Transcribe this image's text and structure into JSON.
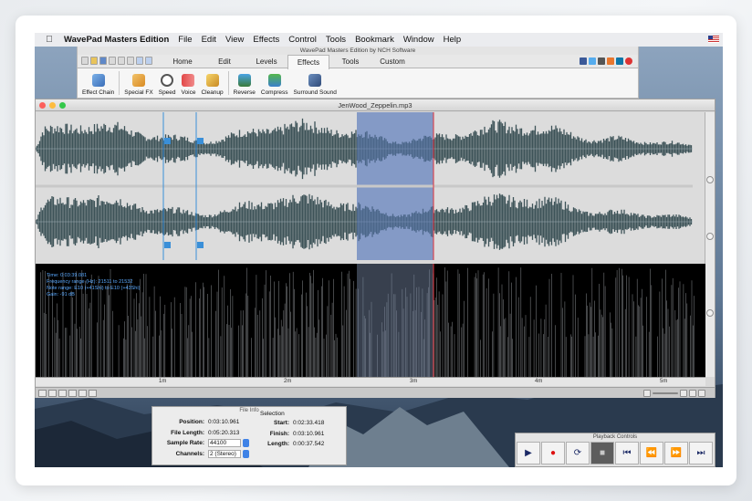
{
  "menubar": {
    "app_name": "WavePad Masters Edition",
    "items": [
      "File",
      "Edit",
      "View",
      "Effects",
      "Control",
      "Tools",
      "Bookmark",
      "Window",
      "Help"
    ]
  },
  "ribbon": {
    "window_title": "WavePad Masters Edition by NCH Software",
    "tabs": [
      "Home",
      "Edit",
      "Levels",
      "Effects",
      "Tools",
      "Custom"
    ],
    "active_tab": "Effects",
    "tools": [
      "Effect Chain",
      "Special FX",
      "Speed",
      "Voice",
      "Cleanup",
      "Reverse",
      "Compress",
      "Surround Sound"
    ]
  },
  "editor": {
    "file_title": "JenWood_Zeppelin.mp3",
    "spectrogram_info": [
      "Time: 0:03:39.081",
      "Frequency range (Hz): 21511 to 21532",
      "Note range: E10 (+41Shi) to E10 (+43Shi)",
      "Gain: -91 dB"
    ],
    "timeline_labels": [
      "1m",
      "2m",
      "3m",
      "4m",
      "5m"
    ],
    "markers": [
      "1",
      "2"
    ]
  },
  "file_info": {
    "title": "File Info",
    "position_label": "Position:",
    "position": "0:03:10.961",
    "length_label": "File Length:",
    "length": "0:05:20.313",
    "rate_label": "Sample Rate:",
    "rate": "44100",
    "channels_label": "Channels:",
    "channels": "2 (Stereo)",
    "selection_label": "Selection",
    "start_label": "Start:",
    "start": "0:02:33.418",
    "finish_label": "Finish:",
    "finish": "0:03:10.961",
    "sel_length_label": "Length:",
    "sel_length": "0:00:37.542"
  },
  "playback": {
    "title": "Playback Controls",
    "buttons": [
      "play",
      "record",
      "loop",
      "stop",
      "go-to-start",
      "rewind",
      "fast-forward",
      "go-to-end"
    ]
  },
  "colors": {
    "wave": "#3d5358",
    "selection": "#5a78b4",
    "accent": "#3f82e6",
    "playhead": "#e0303a"
  }
}
